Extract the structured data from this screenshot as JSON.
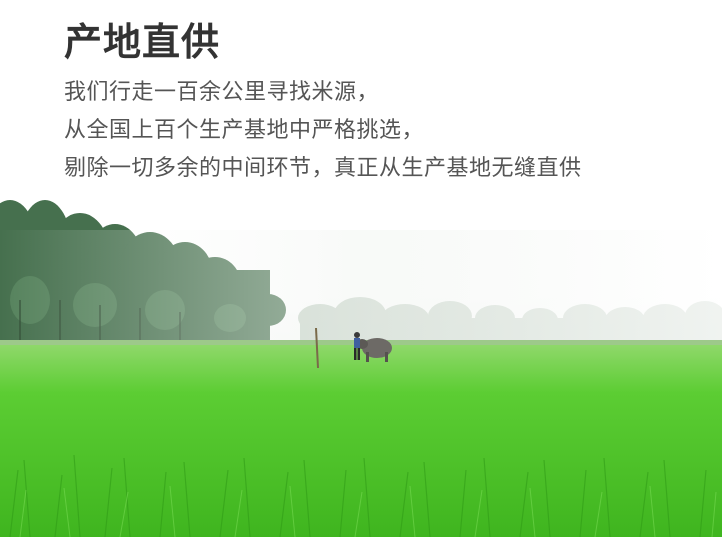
{
  "hero": {
    "title": "产地直供",
    "lines": [
      "我们行走一百余公里寻找米源，",
      "从全国上百个生产基地中严格挑选，",
      "剔除一切多余的中间环节，真正从生产基地无缝直供"
    ]
  },
  "colors": {
    "title": "#333333",
    "body_text": "#555555",
    "sky": "#ffffff",
    "rice_field": "#4cc42a",
    "trees": "#3d6b45"
  },
  "icons": {
    "scene": "rice-field-photo"
  }
}
